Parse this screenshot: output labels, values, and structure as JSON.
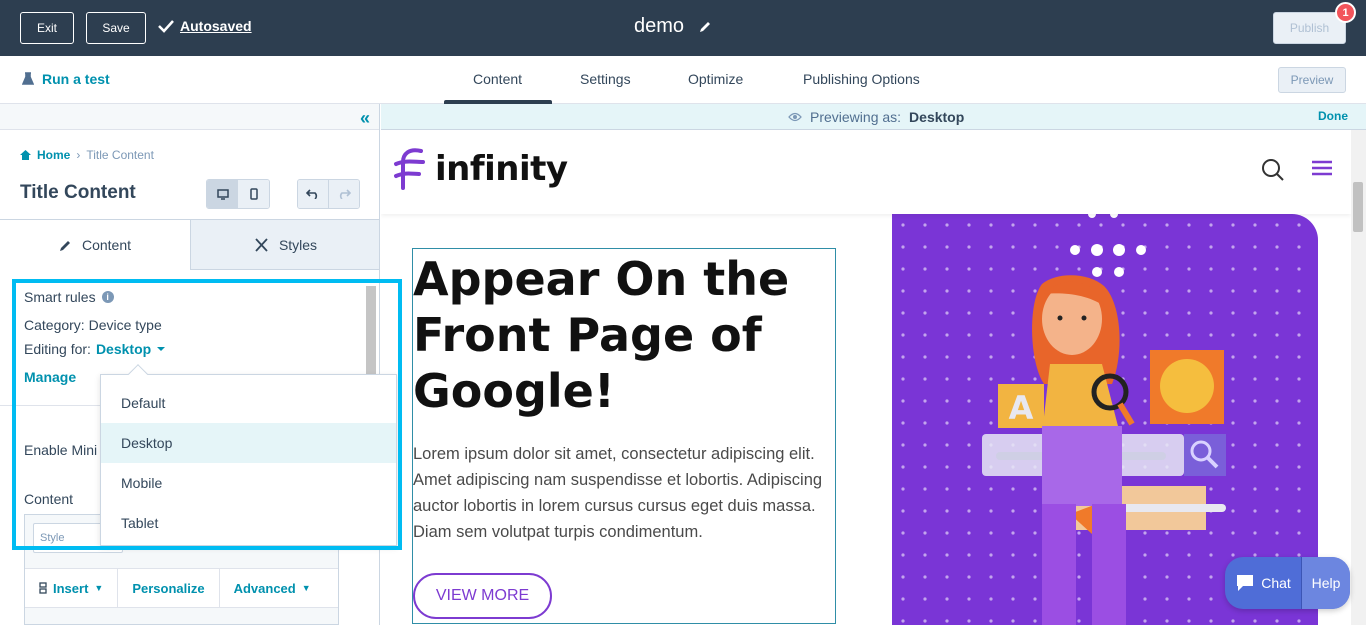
{
  "topbar": {
    "exit_label": "Exit",
    "save_label": "Save",
    "autosaved_label": "Autosaved",
    "page_title": "demo",
    "publish_label": "Publish",
    "notification_count": "1"
  },
  "nav": {
    "run_test_label": "Run a test",
    "tabs": [
      {
        "label": "Content",
        "active": true
      },
      {
        "label": "Settings",
        "active": false
      },
      {
        "label": "Optimize",
        "active": false
      },
      {
        "label": "Publishing Options",
        "active": false
      }
    ],
    "preview_label": "Preview"
  },
  "left_panel": {
    "breadcrumb": {
      "home": "Home",
      "current": "Title Content"
    },
    "title": "Title Content",
    "tabs": [
      {
        "label": "Content"
      },
      {
        "label": "Styles"
      }
    ],
    "smart_rules": {
      "label": "Smart rules",
      "category": "Category: Device type",
      "editing_for_label": "Editing for:",
      "editing_for_value": "Desktop",
      "manage_label": "Manage"
    },
    "enable_label": "Enable Mini",
    "content_label": "Content",
    "editor": {
      "style_placeholder": "Style",
      "toolbar": [
        "Insert",
        "Personalize",
        "Advanced"
      ]
    }
  },
  "dropdown": {
    "options": [
      "Default",
      "Desktop",
      "Mobile",
      "Tablet"
    ],
    "selected": "Desktop"
  },
  "preview": {
    "previewing_label": "Previewing as:",
    "previewing_value": "Desktop",
    "done_label": "Done"
  },
  "site": {
    "logo_text": "infinity",
    "hero_title": "Appear On the Front  Page of Google!",
    "hero_body": "Lorem ipsum dolor sit amet, consectetur adipiscing elit. Amet adipiscing nam suspendisse et lobortis. Adipiscing auctor lobortis in lorem cursus cursus eget duis massa. Diam sem volutpat turpis condimentum.",
    "cta_label": "VIEW MORE",
    "brand_color": "#7d3bd1"
  },
  "chat": {
    "chat_label": "Chat",
    "help_label": "Help"
  }
}
